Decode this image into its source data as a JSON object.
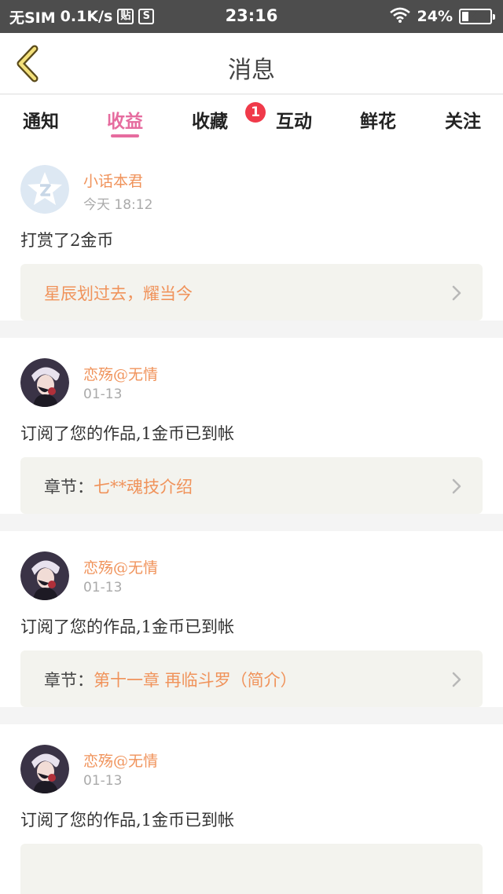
{
  "status_bar": {
    "carrier": "无SIM",
    "speed": "0.1K/s",
    "icon_post": "贴",
    "icon_s": "S",
    "time": "23:16",
    "battery": "24%",
    "battery_level": 0.24
  },
  "header": {
    "title": "消息"
  },
  "tabs": [
    {
      "label": "通知"
    },
    {
      "label": "收益"
    },
    {
      "label": "收藏",
      "badge": "1"
    },
    {
      "label": "互动"
    },
    {
      "label": "鲜花"
    },
    {
      "label": "关注"
    }
  ],
  "active_tab": "收益",
  "colors": {
    "accent_pink": "#e66c9f",
    "name_orange": "#f0935b",
    "badge_red": "#f03a4a",
    "ref_box_bg": "#f3f3ee"
  },
  "items": [
    {
      "avatar": "default-star-avatar",
      "username": "小话本君",
      "date": "今天  18:12",
      "action": "打赏了2金币",
      "ref_prefix": "",
      "ref_value": "星辰划过去，耀当今"
    },
    {
      "avatar": "anime-character-avatar",
      "username": "恋殇@无情",
      "date": "01-13",
      "action": "订阅了您的作品,1金币已到帐",
      "ref_prefix": "章节：",
      "ref_value": "七**魂技介绍"
    },
    {
      "avatar": "anime-character-avatar",
      "username": "恋殇@无情",
      "date": "01-13",
      "action": "订阅了您的作品,1金币已到帐",
      "ref_prefix": "章节：",
      "ref_value": "第十一章 再临斗罗（简介）"
    },
    {
      "avatar": "anime-character-avatar",
      "username": "恋殇@无情",
      "date": "01-13",
      "action": "订阅了您的作品,1金币已到帐",
      "ref_prefix": "",
      "ref_value": ""
    }
  ]
}
